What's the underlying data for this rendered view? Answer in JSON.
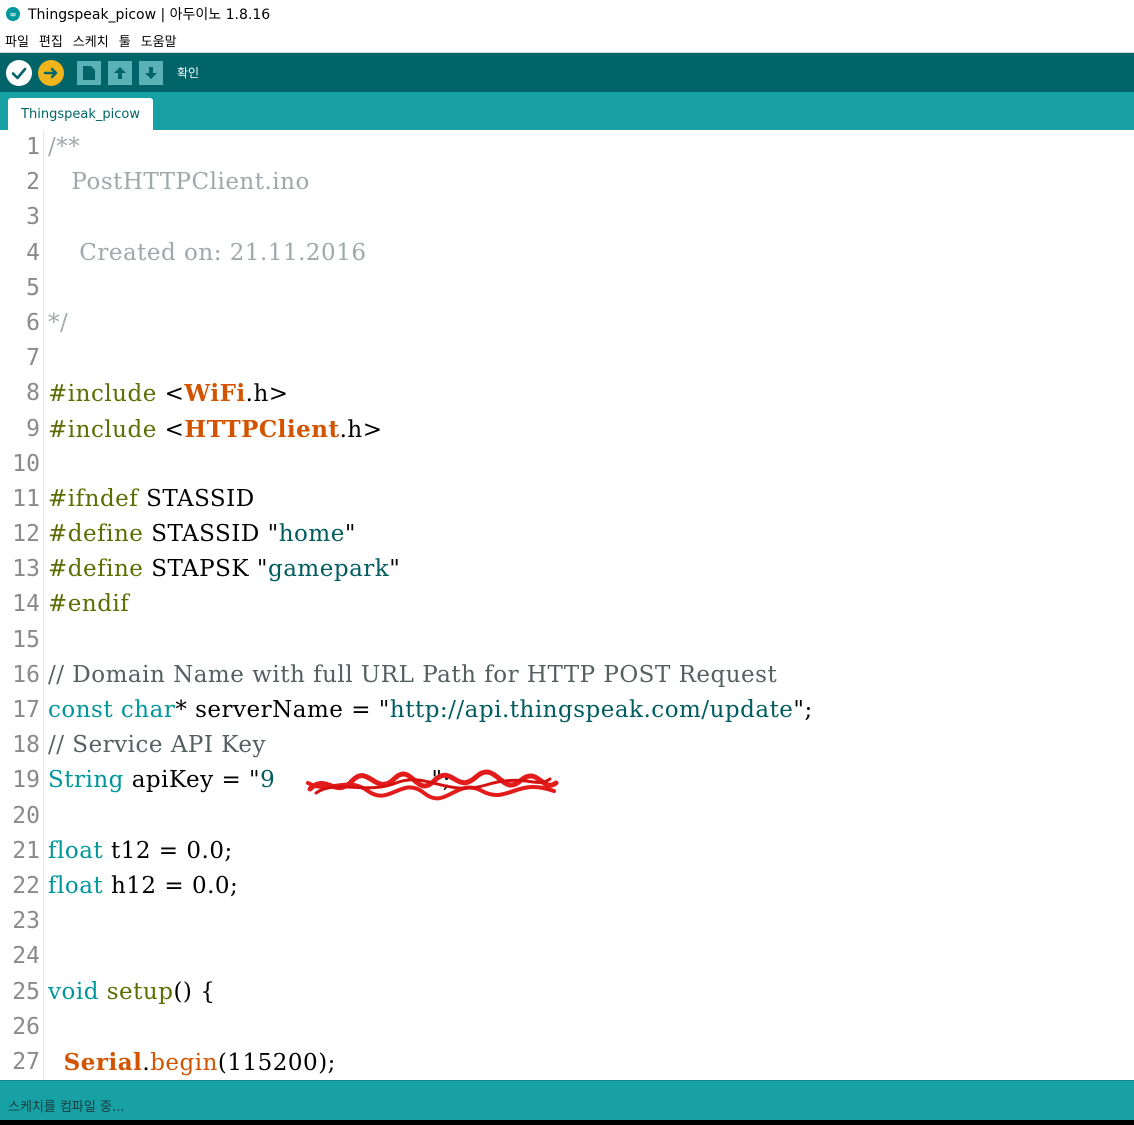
{
  "window": {
    "title": "Thingspeak_picow | 아두이노 1.8.16"
  },
  "menu": {
    "items": [
      "파일",
      "편집",
      "스케치",
      "툴",
      "도움말"
    ]
  },
  "toolbar": {
    "hint": "확인",
    "buttons": [
      "verify-icon",
      "upload-icon",
      "new-icon",
      "open-icon",
      "save-icon"
    ],
    "colors": {
      "verify": "#ffffff",
      "upload": "#f0b41c",
      "bar": "#006468"
    }
  },
  "tabs": [
    {
      "label": "Thingspeak_picow",
      "active": true
    }
  ],
  "editor": {
    "lines": [
      {
        "n": "1",
        "segments": [
          {
            "t": "/**",
            "c": "comment"
          }
        ]
      },
      {
        "n": "2",
        "segments": [
          {
            "t": "   PostHTTPClient.ino",
            "c": "comment"
          }
        ]
      },
      {
        "n": "3",
        "segments": []
      },
      {
        "n": "4",
        "segments": [
          {
            "t": "    Created on: 21.11.2016",
            "c": "comment"
          }
        ]
      },
      {
        "n": "5",
        "segments": []
      },
      {
        "n": "6",
        "segments": [
          {
            "t": "*/",
            "c": "comment"
          }
        ]
      },
      {
        "n": "7",
        "segments": []
      },
      {
        "n": "8",
        "segments": [
          {
            "t": "#include ",
            "c": "pre"
          },
          {
            "t": "<",
            "c": "plain"
          },
          {
            "t": "WiFi",
            "c": "lib"
          },
          {
            "t": ".h>",
            "c": "plain"
          }
        ]
      },
      {
        "n": "9",
        "segments": [
          {
            "t": "#include ",
            "c": "pre"
          },
          {
            "t": "<",
            "c": "plain"
          },
          {
            "t": "HTTPClient",
            "c": "lib"
          },
          {
            "t": ".h>",
            "c": "plain"
          }
        ]
      },
      {
        "n": "10",
        "segments": []
      },
      {
        "n": "11",
        "segments": [
          {
            "t": "#ifndef ",
            "c": "pre"
          },
          {
            "t": "STASSID",
            "c": "plain"
          }
        ]
      },
      {
        "n": "12",
        "segments": [
          {
            "t": "#define ",
            "c": "pre"
          },
          {
            "t": "STASSID ",
            "c": "plain"
          },
          {
            "t": "\"",
            "c": "plain"
          },
          {
            "t": "home",
            "c": "str"
          },
          {
            "t": "\"",
            "c": "plain"
          }
        ]
      },
      {
        "n": "13",
        "segments": [
          {
            "t": "#define ",
            "c": "pre"
          },
          {
            "t": "STAPSK ",
            "c": "plain"
          },
          {
            "t": "\"",
            "c": "plain"
          },
          {
            "t": "gamepark",
            "c": "str"
          },
          {
            "t": "\"",
            "c": "plain"
          }
        ]
      },
      {
        "n": "14",
        "segments": [
          {
            "t": "#endif",
            "c": "pre"
          }
        ]
      },
      {
        "n": "15",
        "segments": []
      },
      {
        "n": "16",
        "segments": [
          {
            "t": "// Domain Name with full URL Path for HTTP POST Request",
            "c": "comment-dark"
          }
        ]
      },
      {
        "n": "17",
        "segments": [
          {
            "t": "const ",
            "c": "type"
          },
          {
            "t": "char",
            "c": "type"
          },
          {
            "t": "* serverName = ",
            "c": "plain"
          },
          {
            "t": "\"",
            "c": "plain"
          },
          {
            "t": "http://api.thingspeak.com/update",
            "c": "str"
          },
          {
            "t": "\";",
            "c": "plain"
          }
        ]
      },
      {
        "n": "18",
        "segments": [
          {
            "t": "// Service API Key",
            "c": "comment-dark"
          }
        ]
      },
      {
        "n": "19",
        "segments": [
          {
            "t": "String",
            "c": "type"
          },
          {
            "t": " apiKey = \"",
            "c": "plain"
          },
          {
            "t": "9",
            "c": "str"
          },
          {
            "t": "                    ",
            "c": "plain"
          },
          {
            "t": "\";",
            "c": "plain"
          }
        ]
      },
      {
        "n": "20",
        "segments": []
      },
      {
        "n": "21",
        "segments": [
          {
            "t": "float",
            "c": "type"
          },
          {
            "t": " t12 = 0.0;",
            "c": "plain"
          }
        ]
      },
      {
        "n": "22",
        "segments": [
          {
            "t": "float",
            "c": "type"
          },
          {
            "t": " h12 = 0.0;",
            "c": "plain"
          }
        ]
      },
      {
        "n": "23",
        "segments": []
      },
      {
        "n": "24",
        "segments": []
      },
      {
        "n": "25",
        "segments": [
          {
            "t": "void",
            "c": "type"
          },
          {
            "t": " ",
            "c": "plain"
          },
          {
            "t": "setup",
            "c": "func"
          },
          {
            "t": "() {",
            "c": "plain"
          }
        ]
      },
      {
        "n": "26",
        "segments": []
      },
      {
        "n": "27",
        "segments": [
          {
            "t": "  ",
            "c": "plain"
          },
          {
            "t": "Serial",
            "c": "kw-orange"
          },
          {
            "t": ".",
            "c": "plain"
          },
          {
            "t": "begin",
            "c": "lib-light"
          },
          {
            "t": "(115200);",
            "c": "plain"
          }
        ]
      }
    ]
  },
  "status": {
    "text": "스케치를 컴파일 중..."
  }
}
